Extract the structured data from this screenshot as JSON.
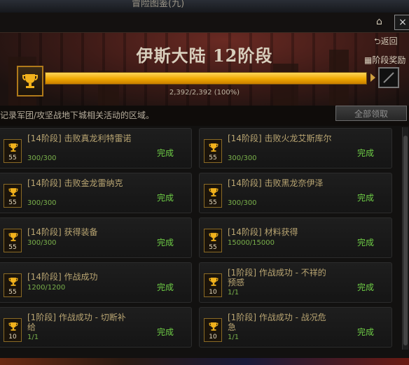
{
  "window_title": "冒险图鉴(九)",
  "nav": {
    "back_label": "⮌返回",
    "close_label": "×",
    "stage_reward_label": "阶段奖励"
  },
  "header": {
    "title": "伊斯大陆 12阶段",
    "progress_text": "2,392/2,392 (100%)",
    "progress_fraction": 1.0
  },
  "description": "记录军团/攻坚战地下城相关活动的区域。",
  "claim_all_label": "全部领取",
  "colors": {
    "accent_gold": "#f0a800",
    "complete_green": "#6fcf46"
  },
  "quests": [
    {
      "level": "55",
      "name": "[14阶段] 击败真龙利特雷诺",
      "progress": "300/300",
      "status": "完成"
    },
    {
      "level": "55",
      "name": "[14阶段] 击败火龙艾斯库尔",
      "progress": "300/300",
      "status": "完成"
    },
    {
      "level": "55",
      "name": "[14阶段] 击败金龙雷纳克",
      "progress": "300/300",
      "status": "完成"
    },
    {
      "level": "55",
      "name": "[14阶段] 击败黑龙奈伊泽",
      "progress": "300/300",
      "status": "完成"
    },
    {
      "level": "55",
      "name": "[14阶段] 获得装备",
      "progress": "300/300",
      "status": "完成"
    },
    {
      "level": "55",
      "name": "[14阶段] 材料获得",
      "progress": "15000/15000",
      "status": "完成"
    },
    {
      "level": "55",
      "name": "[14阶段] 作战成功",
      "progress": "1200/1200",
      "status": "完成"
    },
    {
      "level": "10",
      "name": "[1阶段] 作战成功 - 不祥的预感",
      "progress": "1/1",
      "status": "完成"
    },
    {
      "level": "10",
      "name": "[1阶段] 作战成功 - 切断补给",
      "progress": "1/1",
      "status": "完成"
    },
    {
      "level": "10",
      "name": "[1阶段] 作战成功 - 战况危急",
      "progress": "1/1",
      "status": "完成"
    }
  ]
}
